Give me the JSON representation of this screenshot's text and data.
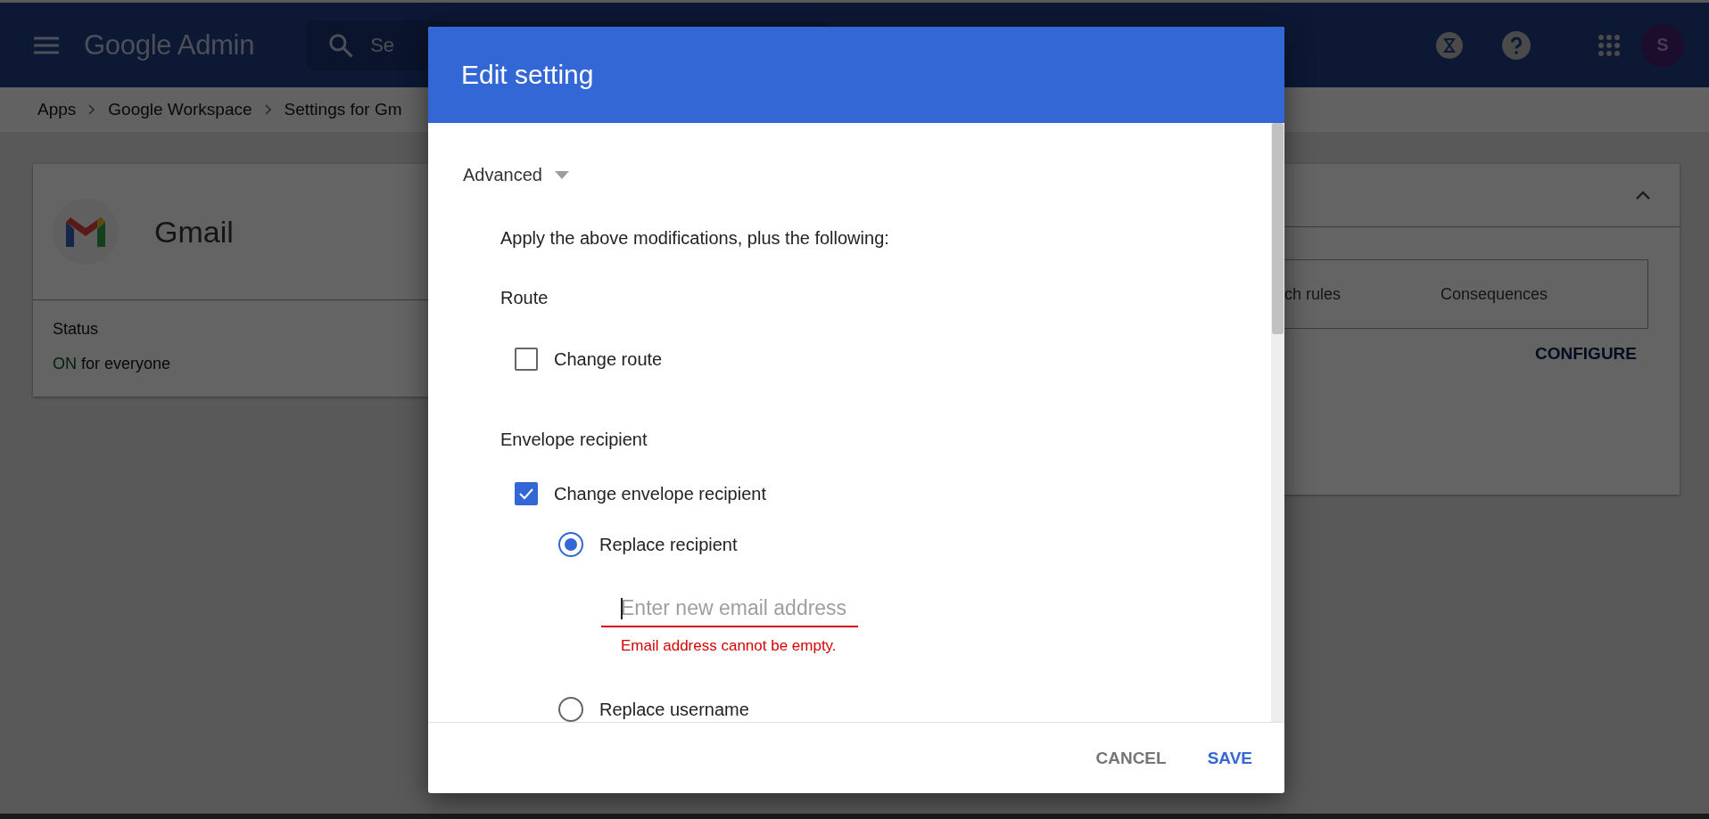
{
  "topbar": {
    "product": "Google Admin",
    "search_placeholder": "Se",
    "avatar": "S"
  },
  "breadcrumbs": [
    "Apps",
    "Google Workspace",
    "Settings for Gm"
  ],
  "app_card": {
    "name": "Gmail",
    "status_label": "Status",
    "status_value": "ON",
    "status_detail": "for everyone"
  },
  "rules_card": {
    "expanded": true,
    "columns": [
      "ch rules",
      "Consequences"
    ],
    "action": "CONFIGURE"
  },
  "dialog": {
    "title": "Edit setting",
    "section": {
      "label": "Advanced",
      "expanded": true
    },
    "intro": "Apply the above modifications, plus the following:",
    "groups": [
      {
        "heading": "Route",
        "options": [
          {
            "kind": "checkbox",
            "label": "Change route",
            "checked": false
          }
        ]
      },
      {
        "heading": "Envelope recipient",
        "options": [
          {
            "kind": "checkbox",
            "label": "Change envelope recipient",
            "checked": true,
            "children": [
              {
                "kind": "radio",
                "label": "Replace recipient",
                "selected": true,
                "field": {
                  "placeholder": "Enter new email address",
                  "error": "Email address cannot be empty."
                }
              },
              {
                "kind": "radio",
                "label": "Replace username",
                "selected": false
              }
            ]
          }
        ]
      }
    ],
    "buttons": [
      {
        "label": "CANCEL",
        "kind": "secondary"
      },
      {
        "label": "SAVE",
        "kind": "primary"
      }
    ]
  }
}
